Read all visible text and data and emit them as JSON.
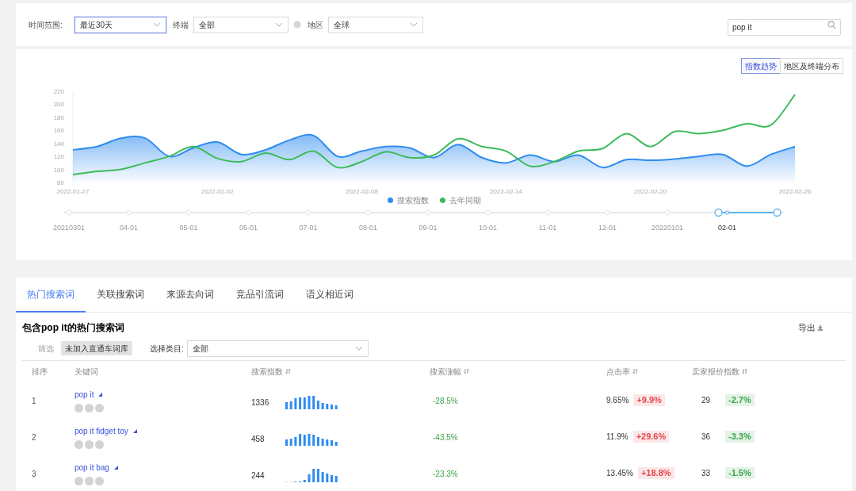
{
  "filters": [
    {
      "kind": "select",
      "label": "时间范围:",
      "value": "最近30天",
      "focused": true,
      "info_icon": false
    },
    {
      "kind": "select",
      "label": "终端",
      "value": "全部",
      "focused": false,
      "info_icon": false
    },
    {
      "kind": "select",
      "label": "地区",
      "value": "全球",
      "focused": false,
      "info_icon": true
    }
  ],
  "search": {
    "value": "pop it"
  },
  "chart_panel": {
    "view_toggle": [
      {
        "label": "指数趋势",
        "selected": true
      },
      {
        "label": "地区及终端分布",
        "selected": false
      }
    ],
    "chart_data": {
      "type": "area",
      "xlim": [
        "2022-01-27",
        "2022-02-26"
      ],
      "x": [
        "2022-01-27",
        "2022-01-28",
        "2022-01-29",
        "2022-01-30",
        "2022-01-31",
        "2022-02-01",
        "2022-02-02",
        "2022-02-03",
        "2022-02-04",
        "2022-02-05",
        "2022-02-06",
        "2022-02-07",
        "2022-02-08",
        "2022-02-09",
        "2022-02-10",
        "2022-02-11",
        "2022-02-12",
        "2022-02-13",
        "2022-02-14",
        "2022-02-15",
        "2022-02-16",
        "2022-02-17",
        "2022-02-18",
        "2022-02-19",
        "2022-02-20",
        "2022-02-21",
        "2022-02-22",
        "2022-02-23",
        "2022-02-24",
        "2022-02-25",
        "2022-02-26"
      ],
      "xticks": [
        "2022-01-27",
        "2022-02-02",
        "2022-02-08",
        "2022-02-14",
        "2022-02-20",
        "2022-02-26"
      ],
      "ylim": [
        80,
        220
      ],
      "yticks": [
        80,
        100,
        120,
        140,
        160,
        180,
        200,
        220
      ],
      "series": [
        {
          "name": "搜索指数",
          "color": "#2f8cf0",
          "type": "area",
          "values": [
            130,
            135,
            148,
            148,
            120,
            133,
            142,
            123,
            130,
            145,
            152,
            120,
            128,
            135,
            133,
            118,
            138,
            118,
            110,
            122,
            112,
            122,
            103,
            115,
            114,
            116,
            120,
            123,
            105,
            123,
            135
          ]
        },
        {
          "name": "去年同期",
          "color": "#3dbb5a",
          "type": "line",
          "values": [
            92,
            97,
            100,
            110,
            120,
            135,
            117,
            112,
            125,
            115,
            128,
            103,
            112,
            127,
            118,
            122,
            147,
            135,
            128,
            105,
            112,
            128,
            132,
            155,
            135,
            158,
            155,
            160,
            170,
            168,
            215
          ]
        }
      ]
    },
    "timeline": [
      {
        "label": "20210301",
        "selected": false
      },
      {
        "label": "04-01",
        "selected": false
      },
      {
        "label": "05-01",
        "selected": false
      },
      {
        "label": "06-01",
        "selected": false
      },
      {
        "label": "07-01",
        "selected": false
      },
      {
        "label": "08-01",
        "selected": false
      },
      {
        "label": "09-01",
        "selected": false
      },
      {
        "label": "10-01",
        "selected": false
      },
      {
        "label": "11-01",
        "selected": false
      },
      {
        "label": "12-01",
        "selected": false
      },
      {
        "label": "20220101",
        "selected": false
      },
      {
        "label": "02-01",
        "selected": true
      }
    ]
  },
  "tabs": [
    {
      "label": "热门搜索词",
      "selected": true
    },
    {
      "label": "关联搜索词",
      "selected": false
    },
    {
      "label": "来源去向词",
      "selected": false
    },
    {
      "label": "竞品引流词",
      "selected": false
    },
    {
      "label": "语义相近词",
      "selected": false
    }
  ],
  "section": {
    "title": "包含pop it的热门搜索词",
    "export": "导出",
    "filter_label": "筛选",
    "chip": "未加入直通车词库",
    "category": {
      "label": "选择类目:",
      "value": "全部"
    }
  },
  "table": {
    "columns": [
      {
        "label": "排序",
        "sortable": false
      },
      {
        "label": "关键词",
        "sortable": false
      },
      {
        "label": "搜索指数",
        "sortable": true
      },
      {
        "label": "搜索涨幅",
        "sortable": true
      },
      {
        "label": "点击率",
        "sortable": true
      },
      {
        "label": "卖家报价指数",
        "sortable": true
      }
    ],
    "rows": [
      {
        "rank": "1",
        "keyword": "pop it",
        "index": "1336",
        "growth": {
          "text": "-28.5%",
          "color": "#3aa54a"
        },
        "ctr": "9.65%",
        "ctr_change": {
          "text": "+9.9%",
          "color": "#e5484d"
        },
        "seller_index": "29",
        "seller_change": {
          "text": "-2.7%",
          "color": "#3aa54a"
        }
      },
      {
        "rank": "2",
        "keyword": "pop it fidget toy",
        "index": "458",
        "growth": {
          "text": "-43.5%",
          "color": "#3aa54a"
        },
        "ctr": "11.9%",
        "ctr_change": {
          "text": "+29.6%",
          "color": "#e5484d"
        },
        "seller_index": "36",
        "seller_change": {
          "text": "-3.3%",
          "color": "#3aa54a"
        }
      },
      {
        "rank": "3",
        "keyword": "pop it bag",
        "index": "244",
        "growth": {
          "text": "-23.3%",
          "color": "#3aa54a"
        },
        "ctr": "13.45%",
        "ctr_change": {
          "text": "+18.8%",
          "color": "#e5484d"
        },
        "seller_index": "33",
        "seller_change": {
          "text": "-1.5%",
          "color": "#3aa54a"
        }
      }
    ]
  }
}
